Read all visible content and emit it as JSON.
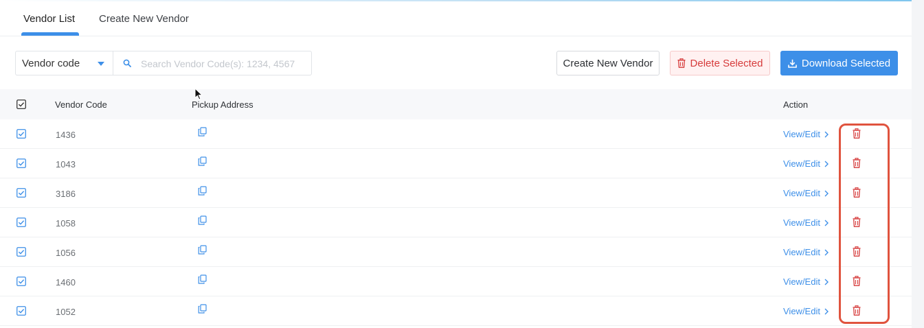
{
  "tabs": [
    {
      "label": "Vendor List",
      "active": true
    },
    {
      "label": "Create New Vendor",
      "active": false
    }
  ],
  "toolbar": {
    "filter_selected": "Vendor code",
    "search_placeholder": "Search Vendor Code(s): 1234, 4567",
    "search_value": "",
    "create_label": "Create New Vendor",
    "delete_label": "Delete Selected",
    "download_label": "Download Selected"
  },
  "table": {
    "headers": {
      "code": "Vendor Code",
      "address": "Pickup Address",
      "action": "Action"
    },
    "header_checked": true,
    "rows": [
      {
        "code": "1436",
        "action_label": "View/Edit",
        "checked": true
      },
      {
        "code": "1043",
        "action_label": "View/Edit",
        "checked": true
      },
      {
        "code": "3186",
        "action_label": "View/Edit",
        "checked": true
      },
      {
        "code": "1058",
        "action_label": "View/Edit",
        "checked": true
      },
      {
        "code": "1056",
        "action_label": "View/Edit",
        "checked": true
      },
      {
        "code": "1460",
        "action_label": "View/Edit",
        "checked": true
      },
      {
        "code": "1052",
        "action_label": "View/Edit",
        "checked": true
      }
    ]
  },
  "colors": {
    "accent": "#3d8fe8",
    "danger": "#d63a3a",
    "highlight": "#e0533e"
  },
  "icons": {
    "select": "chevron-down-icon",
    "search": "search-icon",
    "delete": "trash-icon",
    "download": "download-icon",
    "address": "copy-icon",
    "view_edit": "chevron-right-icon"
  }
}
